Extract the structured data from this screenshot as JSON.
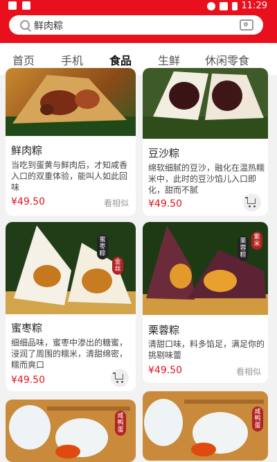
{
  "status": {
    "time": "11:29"
  },
  "search": {
    "value": "鲜肉粽"
  },
  "tabs": [
    {
      "label": "首页"
    },
    {
      "label": "手机"
    },
    {
      "label": "食品"
    },
    {
      "label": "生鲜"
    },
    {
      "label": "休闲零食"
    }
  ],
  "products": [
    {
      "title": "鲜肉粽",
      "desc": "当吃到蛋黄与鲜肉后，才知咸香入口的双重体验，能叫人如此回味",
      "price": "¥49.50",
      "action": "看相似"
    },
    {
      "title": "豆沙粽",
      "desc": "绵软细腻的豆沙，融化在温热糯米中，此时的豆沙馅儿入口即化，甜而不腻",
      "price": "¥49.50"
    },
    {
      "title": "蜜枣粽",
      "desc": "细细品味，蜜枣中渗出的糖蜜，浸润了周围的糯米，清甜绵密，糯而爽口",
      "price": "¥49.50"
    },
    {
      "title": "栗蓉粽",
      "desc": "清甜口味，料多馅足，满足你的挑剔味蕾",
      "price": "¥49.50",
      "action": "看相似"
    }
  ],
  "badges": {
    "jinsi": "金丝",
    "mizao": "蜜枣粽",
    "zimi": "紫米",
    "lirong": "栗蓉粽",
    "xianyadan": "咸鸭蛋"
  },
  "colors": {
    "brand": "#e8101c",
    "price": "#e8101c"
  }
}
